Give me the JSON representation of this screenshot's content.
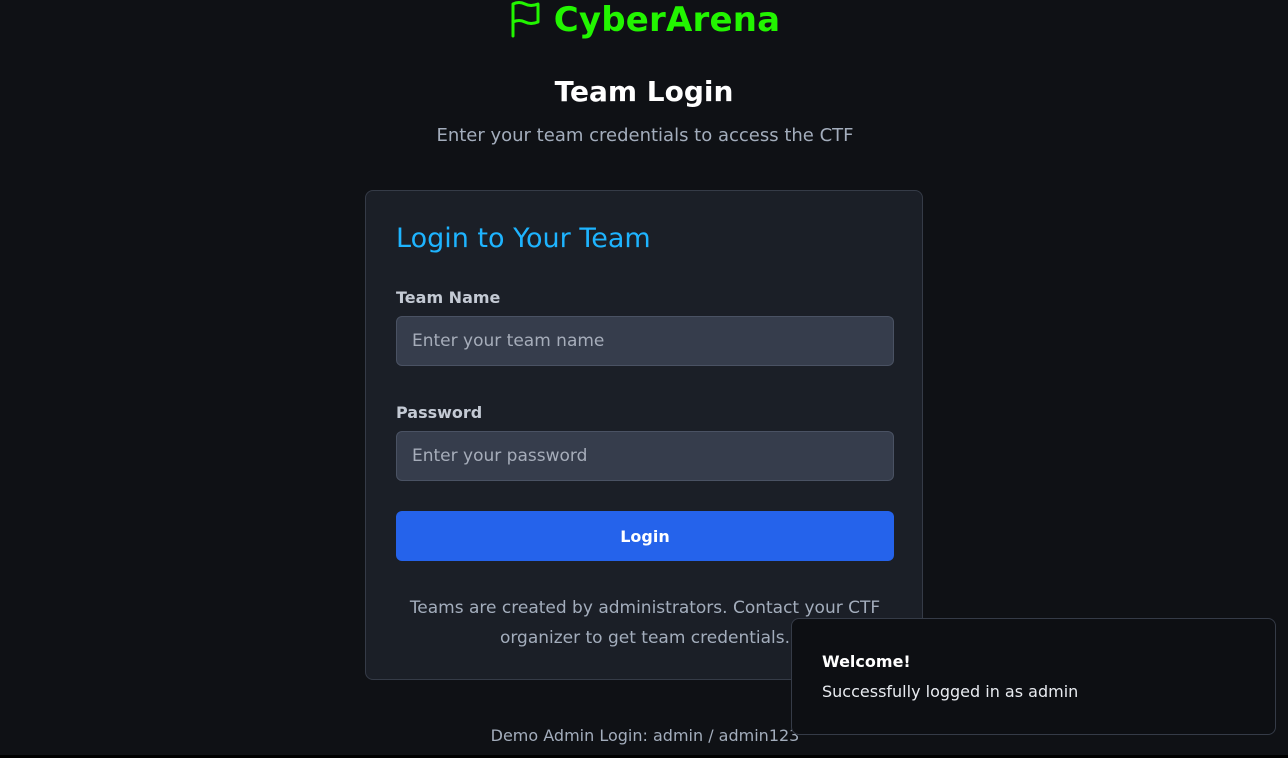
{
  "brand": {
    "name": "CyberArena",
    "icon": "flag-icon",
    "color": "#22f500"
  },
  "header": {
    "title": "Team Login",
    "subtitle": "Enter your team credentials to access the CTF"
  },
  "login_card": {
    "title": "Login to Your Team",
    "team_name_label": "Team Name",
    "team_name_value": "",
    "team_name_placeholder": "Enter your team name",
    "password_label": "Password",
    "password_value": "",
    "password_placeholder": "Enter your password",
    "login_button_label": "Login",
    "info_text": "Teams are created by administrators. Contact your CTF organizer to get team credentials."
  },
  "footer": {
    "demo_note": "Demo Admin Login: admin / admin123"
  },
  "toast": {
    "title": "Welcome!",
    "message": "Successfully logged in as admin"
  },
  "colors": {
    "background": "#0f1115",
    "card": "#1b1f27",
    "accent_title": "#1eb4ff",
    "button": "#2563eb"
  }
}
